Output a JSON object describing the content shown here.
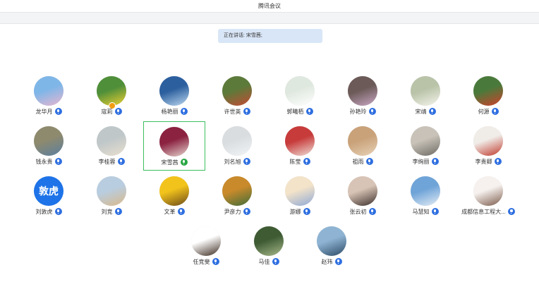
{
  "window": {
    "title": "腾讯会议"
  },
  "speaking": {
    "text": "正在讲话: 宋雪茜;"
  },
  "participants": [
    {
      "name": "龙华月",
      "avatar_icon": "cartoon-avatar-icon",
      "colors": [
        "#7fb6e8",
        "#e8b5d0"
      ],
      "mic": "blue"
    },
    {
      "name": "寇莉",
      "avatar_icon": "yellow-flower-avatar-icon",
      "colors": [
        "#4f8f3a",
        "#f0d030"
      ],
      "mic": "blue",
      "hand": true
    },
    {
      "name": "杨艳丽",
      "avatar_icon": "lake-avatar-icon",
      "colors": [
        "#2c5f9e",
        "#bcd8f0"
      ],
      "mic": "blue"
    },
    {
      "name": "许世英",
      "avatar_icon": "plant-avatar-icon",
      "colors": [
        "#5c7a3a",
        "#c44b33"
      ],
      "mic": "blue"
    },
    {
      "name": "郭曦栢",
      "avatar_icon": "white-flower-avatar-icon",
      "colors": [
        "#dfe8df",
        "#ffffff"
      ],
      "mic": "blue"
    },
    {
      "name": "孙艳玲",
      "avatar_icon": "room-avatar-icon",
      "colors": [
        "#6b5a58",
        "#caa7c4"
      ],
      "mic": "blue"
    },
    {
      "name": "宋靖",
      "avatar_icon": "flowers-avatar-icon",
      "colors": [
        "#b9c3a8",
        "#f4f4ec"
      ],
      "mic": "blue"
    },
    {
      "name": "何源",
      "avatar_icon": "red-berries-avatar-icon",
      "colors": [
        "#4a7a3b",
        "#d1402b"
      ],
      "mic": "blue"
    },
    {
      "name": "钱永贵",
      "avatar_icon": "landscape-avatar-icon",
      "colors": [
        "#8e8a6e",
        "#5b7fa0"
      ],
      "mic": "blue"
    },
    {
      "name": "李桂蓉",
      "avatar_icon": "beach-avatar-icon",
      "colors": [
        "#bfc7c9",
        "#e9dfcf"
      ],
      "mic": "blue"
    },
    {
      "name": "宋雪茜",
      "avatar_icon": "portrait-avatar-icon",
      "colors": [
        "#8b2240",
        "#e6d6d0"
      ],
      "mic": "green",
      "active": true
    },
    {
      "name": "刘名旭",
      "avatar_icon": "foggy-avatar-icon",
      "colors": [
        "#d9dde0",
        "#f2f4f6"
      ],
      "mic": "blue"
    },
    {
      "name": "陈莹",
      "avatar_icon": "doll-avatar-icon",
      "colors": [
        "#c73b3b",
        "#f0e0d8"
      ],
      "mic": "blue"
    },
    {
      "name": "祖雨",
      "avatar_icon": "door-avatar-icon",
      "colors": [
        "#c9a27a",
        "#e7d2b7"
      ],
      "mic": "blue"
    },
    {
      "name": "李绚丽",
      "avatar_icon": "sunset-avatar-icon",
      "colors": [
        "#c8c2b8",
        "#6d6a64"
      ],
      "mic": "blue"
    },
    {
      "name": "李贵卿",
      "avatar_icon": "sketch-avatar-icon",
      "colors": [
        "#f0ece8",
        "#c0392b"
      ],
      "mic": "blue"
    },
    {
      "name": "刘敦虎",
      "avatar_icon": "initials-avatar-icon",
      "initials": "敦虎",
      "colors": [
        "#1e73e8",
        "#1e73e8"
      ],
      "mic": "blue"
    },
    {
      "name": "刘竞",
      "avatar_icon": "tree-avatar-icon",
      "colors": [
        "#b9cde0",
        "#d9b98a"
      ],
      "mic": "blue"
    },
    {
      "name": "文革",
      "avatar_icon": "sunflower-avatar-icon",
      "colors": [
        "#f2c31b",
        "#6b4a1a"
      ],
      "mic": "blue"
    },
    {
      "name": "尹彦力",
      "avatar_icon": "autumn-avatar-icon",
      "colors": [
        "#c98a2b",
        "#3f6d3a"
      ],
      "mic": "blue"
    },
    {
      "name": "游娜",
      "avatar_icon": "cartoon-face-avatar-icon",
      "colors": [
        "#f3e3c9",
        "#8fa9d6"
      ],
      "mic": "blue"
    },
    {
      "name": "张云初",
      "avatar_icon": "selfie-avatar-icon",
      "colors": [
        "#d8c4b6",
        "#3b2e2a"
      ],
      "mic": "blue"
    },
    {
      "name": "马慧知",
      "avatar_icon": "coast-avatar-icon",
      "colors": [
        "#6fa4d8",
        "#e5edf5"
      ],
      "mic": "blue"
    },
    {
      "name": "成都信息工程大...",
      "avatar_icon": "anime-avatar-icon",
      "colors": [
        "#f6f1ee",
        "#7b5a4a"
      ],
      "mic": "blue"
    },
    {
      "name": "任竞斐",
      "avatar_icon": "cartoon-girl-avatar-icon",
      "colors": [
        "#ffffff",
        "#3b2a1e"
      ],
      "mic": "blue"
    },
    {
      "name": "马佳",
      "avatar_icon": "bush-avatar-icon",
      "colors": [
        "#3e5b34",
        "#a8b98a"
      ],
      "mic": "blue"
    },
    {
      "name": "赵玮",
      "avatar_icon": "harbor-avatar-icon",
      "colors": [
        "#8fb4d3",
        "#2b4a66"
      ],
      "mic": "blue"
    }
  ]
}
